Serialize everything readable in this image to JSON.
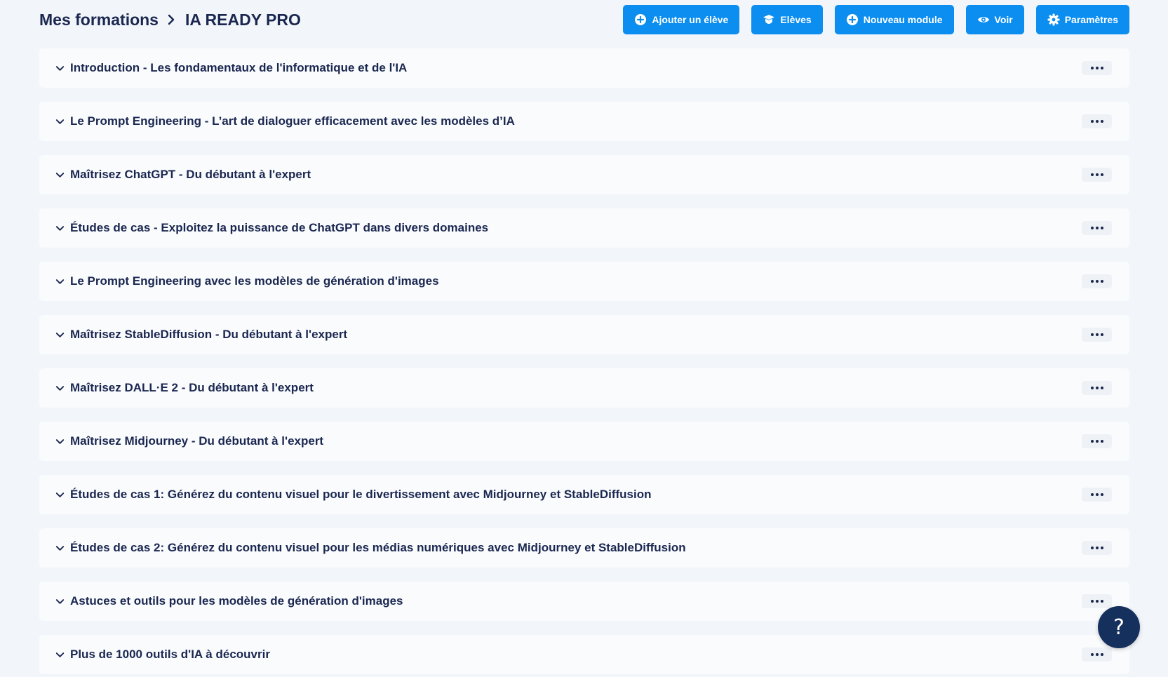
{
  "header": {
    "breadcrumb_root": "Mes formations",
    "breadcrumb_current": "IA READY PRO",
    "separator_icon": "chevron-right-icon"
  },
  "actions": [
    {
      "label": "Ajouter un élève",
      "icon": "plus-circle-icon"
    },
    {
      "label": "Elèves",
      "icon": "graduation-cap-icon"
    },
    {
      "label": "Nouveau module",
      "icon": "plus-circle-icon"
    },
    {
      "label": "Voir",
      "icon": "eye-icon"
    },
    {
      "label": "Paramètres",
      "icon": "gear-icon"
    }
  ],
  "modules": [
    {
      "title": "Introduction - Les fondamentaux de l'informatique et de l'IA"
    },
    {
      "title": "Le Prompt Engineering - L’art de dialoguer efficacement avec les modèles d’IA"
    },
    {
      "title": "Maîtrisez ChatGPT - Du débutant à l'expert"
    },
    {
      "title": "Études de cas - Exploitez la puissance de ChatGPT dans divers domaines"
    },
    {
      "title": "Le Prompt Engineering avec les modèles de génération d'images"
    },
    {
      "title": "Maîtrisez StableDiffusion - Du débutant à l'expert"
    },
    {
      "title": "Maîtrisez DALL·E 2 - Du débutant à l'expert"
    },
    {
      "title": "Maîtrisez Midjourney - Du débutant à l'expert"
    },
    {
      "title": "Études de cas 1: Générez du contenu visuel pour le divertissement avec Midjourney et StableDiffusion"
    },
    {
      "title": "Études de cas 2: Générez du contenu visuel pour les médias numériques avec Midjourney et StableDiffusion"
    },
    {
      "title": "Astuces et outils pour les modèles de génération d'images"
    },
    {
      "title": "Plus de 1000 outils d'IA à découvrir"
    }
  ],
  "help": {
    "label": "?"
  },
  "colors": {
    "accent": "#0b8ef0",
    "text": "#1a2750",
    "background": "#f2f5f9",
    "help_button": "#16305e"
  }
}
